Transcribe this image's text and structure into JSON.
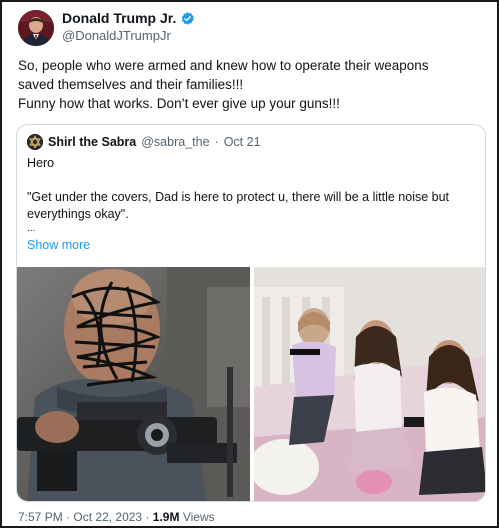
{
  "author": {
    "name": "Donald Trump Jr.",
    "handle": "@DonaldJTrumpJr"
  },
  "tweet": {
    "lines": [
      "So, people who were armed and knew how to operate their weapons",
      "saved themselves and their families!!!",
      "Funny how that works. Don’t ever give up your guns!!!"
    ]
  },
  "quote": {
    "name": "Shirl the Sabra",
    "handle": "@sabra_the",
    "separator": "·",
    "date": "Oct 21",
    "lines": [
      "Hero",
      "",
      "\"Get under the covers, Dad is here to protect u, there will be a little noise but",
      "everythings okay\".",
      "..."
    ],
    "show_more": "Show more"
  },
  "footer": {
    "time": "7:57 PM",
    "sep1": "·",
    "date": "Oct 22, 2023",
    "sep2": "·",
    "views_count": "1.9M",
    "views_label": "Views"
  },
  "colors": {
    "accent": "#1d9bf0",
    "secondary_text": "#536471",
    "border": "#cfd9de"
  },
  "icons": {
    "verified": "verified-badge-icon",
    "quote_avatar": "star-of-david-avatar"
  }
}
